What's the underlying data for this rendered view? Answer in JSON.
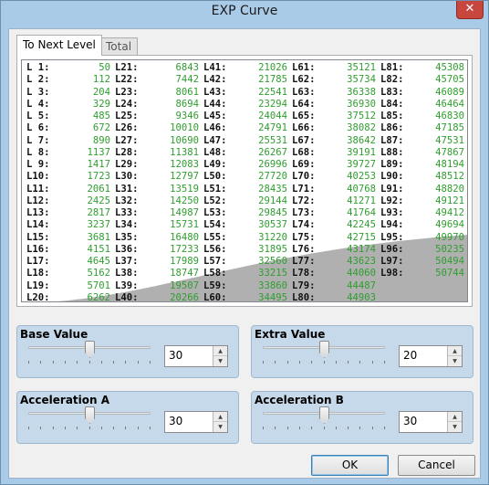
{
  "window": {
    "title": "EXP Curve",
    "close_glyph": "✕"
  },
  "tabs": [
    {
      "label": "To Next Level",
      "active": true
    },
    {
      "label": "Total",
      "active": false
    }
  ],
  "levels": [
    [
      [
        "L 1:",
        "50"
      ],
      [
        "L 2:",
        "112"
      ],
      [
        "L 3:",
        "204"
      ],
      [
        "L 4:",
        "329"
      ],
      [
        "L 5:",
        "485"
      ],
      [
        "L 6:",
        "672"
      ],
      [
        "L 7:",
        "890"
      ],
      [
        "L 8:",
        "1137"
      ],
      [
        "L 9:",
        "1417"
      ],
      [
        "L10:",
        "1723"
      ],
      [
        "L11:",
        "2061"
      ],
      [
        "L12:",
        "2425"
      ],
      [
        "L13:",
        "2817"
      ],
      [
        "L14:",
        "3237"
      ],
      [
        "L15:",
        "3681"
      ],
      [
        "L16:",
        "4151"
      ],
      [
        "L17:",
        "4645"
      ],
      [
        "L18:",
        "5162"
      ],
      [
        "L19:",
        "5701"
      ],
      [
        "L20:",
        "6262"
      ]
    ],
    [
      [
        "L21:",
        "6843"
      ],
      [
        "L22:",
        "7442"
      ],
      [
        "L23:",
        "8061"
      ],
      [
        "L24:",
        "8694"
      ],
      [
        "L25:",
        "9346"
      ],
      [
        "L26:",
        "10010"
      ],
      [
        "L27:",
        "10690"
      ],
      [
        "L28:",
        "11381"
      ],
      [
        "L29:",
        "12083"
      ],
      [
        "L30:",
        "12797"
      ],
      [
        "L31:",
        "13519"
      ],
      [
        "L32:",
        "14250"
      ],
      [
        "L33:",
        "14987"
      ],
      [
        "L34:",
        "15731"
      ],
      [
        "L35:",
        "16480"
      ],
      [
        "L36:",
        "17233"
      ],
      [
        "L37:",
        "17989"
      ],
      [
        "L38:",
        "18747"
      ],
      [
        "L39:",
        "19507"
      ],
      [
        "L40:",
        "20266"
      ]
    ],
    [
      [
        "L41:",
        "21026"
      ],
      [
        "L42:",
        "21785"
      ],
      [
        "L43:",
        "22541"
      ],
      [
        "L44:",
        "23294"
      ],
      [
        "L45:",
        "24044"
      ],
      [
        "L46:",
        "24791"
      ],
      [
        "L47:",
        "25531"
      ],
      [
        "L48:",
        "26267"
      ],
      [
        "L49:",
        "26996"
      ],
      [
        "L50:",
        "27720"
      ],
      [
        "L51:",
        "28435"
      ],
      [
        "L52:",
        "29144"
      ],
      [
        "L53:",
        "29845"
      ],
      [
        "L54:",
        "30537"
      ],
      [
        "L55:",
        "31220"
      ],
      [
        "L56:",
        "31895"
      ],
      [
        "L57:",
        "32560"
      ],
      [
        "L58:",
        "33215"
      ],
      [
        "L59:",
        "33860"
      ],
      [
        "L60:",
        "34495"
      ]
    ],
    [
      [
        "L61:",
        "35121"
      ],
      [
        "L62:",
        "35734"
      ],
      [
        "L63:",
        "36338"
      ],
      [
        "L64:",
        "36930"
      ],
      [
        "L65:",
        "37512"
      ],
      [
        "L66:",
        "38082"
      ],
      [
        "L67:",
        "38642"
      ],
      [
        "L68:",
        "39191"
      ],
      [
        "L69:",
        "39727"
      ],
      [
        "L70:",
        "40253"
      ],
      [
        "L71:",
        "40768"
      ],
      [
        "L72:",
        "41271"
      ],
      [
        "L73:",
        "41764"
      ],
      [
        "L74:",
        "42245"
      ],
      [
        "L75:",
        "42715"
      ],
      [
        "L76:",
        "43174"
      ],
      [
        "L77:",
        "43623"
      ],
      [
        "L78:",
        "44060"
      ],
      [
        "L79:",
        "44487"
      ],
      [
        "L80:",
        "44903"
      ]
    ],
    [
      [
        "L81:",
        "45308"
      ],
      [
        "L82:",
        "45705"
      ],
      [
        "L83:",
        "46089"
      ],
      [
        "L84:",
        "46464"
      ],
      [
        "L85:",
        "46830"
      ],
      [
        "L86:",
        "47185"
      ],
      [
        "L87:",
        "47531"
      ],
      [
        "L88:",
        "47867"
      ],
      [
        "L89:",
        "48194"
      ],
      [
        "L90:",
        "48512"
      ],
      [
        "L91:",
        "48820"
      ],
      [
        "L92:",
        "49121"
      ],
      [
        "L93:",
        "49412"
      ],
      [
        "L94:",
        "49694"
      ],
      [
        "L95:",
        "49970"
      ],
      [
        "L96:",
        "50235"
      ],
      [
        "L97:",
        "50494"
      ],
      [
        "L98:",
        "50744"
      ]
    ]
  ],
  "groups": {
    "base": {
      "title": "Base Value",
      "value": "30",
      "slider_fraction": 0.5
    },
    "extra": {
      "title": "Extra Value",
      "value": "20",
      "slider_fraction": 0.5
    },
    "accel_a": {
      "title": "Acceleration A",
      "value": "30",
      "slider_fraction": 0.5
    },
    "accel_b": {
      "title": "Acceleration B",
      "value": "30",
      "slider_fraction": 0.5
    }
  },
  "buttons": {
    "ok": "OK",
    "cancel": "Cancel"
  },
  "colors": {
    "xp_text": "#2f9e2f",
    "curve_fill": "#b0b0b0"
  }
}
